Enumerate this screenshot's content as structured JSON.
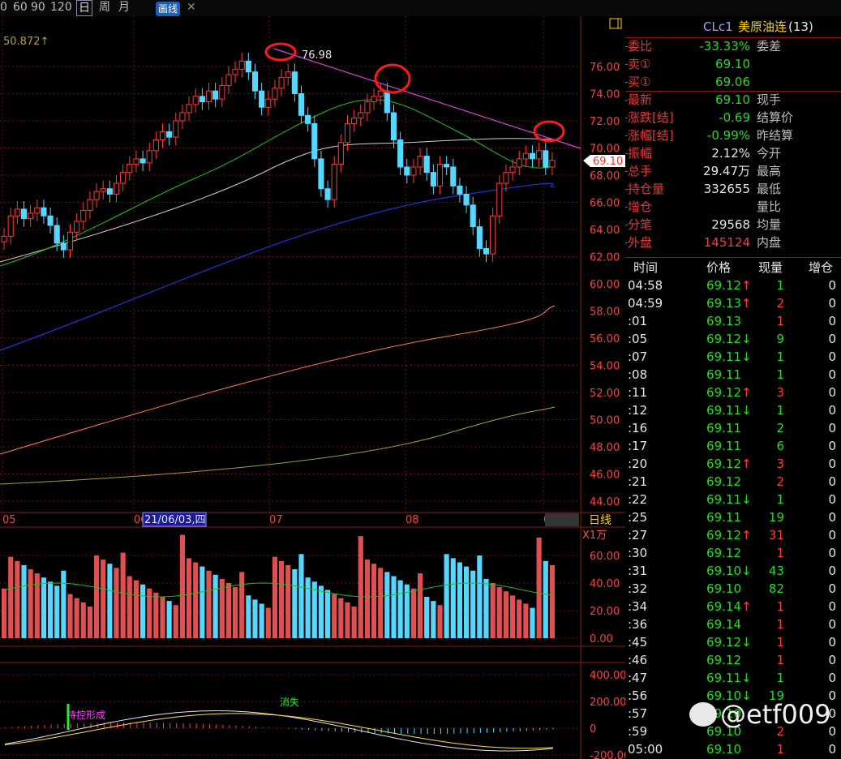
{
  "toolbar": {
    "periods": [
      "0",
      "60",
      "90",
      "120"
    ],
    "day": "日",
    "week": "周",
    "month": "月",
    "draw": "画线"
  },
  "chart": {
    "ma_label": "50.872↑",
    "peak_label": "76.98",
    "price_marker": "69.10",
    "y_ticks": [
      "76.00",
      "74.00",
      "72.00",
      "70.00",
      "68.00",
      "66.00",
      "64.00",
      "62.00",
      "60.00",
      "58.00",
      "56.00",
      "54.00",
      "52.00",
      "50.00",
      "48.00",
      "46.00",
      "44.00"
    ],
    "x_ticks": [
      "05",
      "06",
      "07",
      "08",
      "09"
    ],
    "cursor_date": "21/06/03,四",
    "period_label": "日线",
    "vol_unit": "X1万",
    "vol_ticks": [
      "60.00",
      "40.00",
      "20.00",
      "0.00"
    ],
    "macd_ticks": [
      "400.00",
      "200.00",
      "0",
      "-200.00"
    ],
    "macd_annot_1": "持控形成",
    "macd_annot_2": "消失",
    "colors": {
      "up": "#ff3a3a",
      "down": "#54d8ff",
      "ma_green": "#1fbf1f",
      "ma_white": "#cfcfcf",
      "ma_blue": "#2233dd",
      "ma_orange": "#ff7a4a",
      "ma_olive": "#a0a040",
      "trend": "#d840d8",
      "circle": "#ff1a1a",
      "grid": "#6e1010"
    }
  },
  "quote": {
    "title": "CLc1",
    "name": "美原油连",
    "count": "(13)",
    "rows": [
      {
        "l": "委比",
        "v": "-33.33%",
        "c": "green",
        "r": "委差",
        "rv": ""
      },
      {
        "l": "卖①",
        "v": "69.10",
        "c": "green",
        "r": "",
        "rv": ""
      },
      {
        "l": "买①",
        "v": "69.06",
        "c": "green",
        "r": "",
        "rv": ""
      },
      {
        "l": "最新",
        "v": "69.10",
        "c": "green",
        "r": "现手",
        "rv": ""
      },
      {
        "l": "涨跌[结]",
        "v": "-0.69",
        "c": "green",
        "r": "结算价",
        "rv": ""
      },
      {
        "l": "涨幅[结]",
        "v": "-0.99%",
        "c": "green",
        "r": "昨结算",
        "rv": ""
      },
      {
        "l": "振幅",
        "v": "2.12%",
        "c": "white",
        "r": "今开",
        "rv": ""
      },
      {
        "l": "总手",
        "v": "29.47万",
        "c": "white",
        "r": "最高",
        "rv": ""
      },
      {
        "l": "持仓量",
        "v": "332655",
        "c": "white",
        "r": "最低",
        "rv": ""
      },
      {
        "l": "增仓",
        "v": "",
        "c": "white",
        "r": "量比",
        "rv": ""
      },
      {
        "l": "分笔",
        "v": "29568",
        "c": "white",
        "r": "均量",
        "rv": ""
      },
      {
        "l": "外盘",
        "v": "145124",
        "c": "red",
        "r": "内盘",
        "rv": ""
      }
    ]
  },
  "ticks": {
    "headers": [
      "时间",
      "价格",
      "现量",
      "增仓"
    ],
    "rows": [
      {
        "t": "04:58",
        "p": "69.12",
        "a": "↑",
        "v": "1",
        "vc": "green",
        "o": "0"
      },
      {
        "t": "04:59",
        "p": "69.13",
        "a": "↑",
        "v": "2",
        "vc": "red",
        "o": "0"
      },
      {
        "t": ":01",
        "p": "69.13",
        "a": "",
        "v": "1",
        "vc": "red",
        "o": "0"
      },
      {
        "t": ":05",
        "p": "69.12",
        "a": "↓",
        "v": "9",
        "vc": "green",
        "o": "0"
      },
      {
        "t": ":07",
        "p": "69.11",
        "a": "↓",
        "v": "1",
        "vc": "green",
        "o": "0"
      },
      {
        "t": ":08",
        "p": "69.11",
        "a": "",
        "v": "1",
        "vc": "green",
        "o": "0"
      },
      {
        "t": ":11",
        "p": "69.12",
        "a": "↑",
        "v": "3",
        "vc": "red",
        "o": "0"
      },
      {
        "t": ":12",
        "p": "69.11",
        "a": "↓",
        "v": "1",
        "vc": "green",
        "o": "0"
      },
      {
        "t": ":16",
        "p": "69.11",
        "a": "",
        "v": "2",
        "vc": "green",
        "o": "0"
      },
      {
        "t": ":17",
        "p": "69.11",
        "a": "",
        "v": "6",
        "vc": "green",
        "o": "0"
      },
      {
        "t": ":20",
        "p": "69.12",
        "a": "↑",
        "v": "3",
        "vc": "red",
        "o": "0"
      },
      {
        "t": ":21",
        "p": "69.12",
        "a": "",
        "v": "2",
        "vc": "red",
        "o": "0"
      },
      {
        "t": ":22",
        "p": "69.11",
        "a": "↓",
        "v": "1",
        "vc": "green",
        "o": "0"
      },
      {
        "t": ":25",
        "p": "69.11",
        "a": "",
        "v": "19",
        "vc": "green",
        "o": "0"
      },
      {
        "t": ":27",
        "p": "69.12",
        "a": "↑",
        "v": "31",
        "vc": "red",
        "o": "0"
      },
      {
        "t": ":30",
        "p": "69.12",
        "a": "",
        "v": "1",
        "vc": "red",
        "o": "0"
      },
      {
        "t": ":31",
        "p": "69.10",
        "a": "↓",
        "v": "43",
        "vc": "green",
        "o": "0"
      },
      {
        "t": ":32",
        "p": "69.10",
        "a": "",
        "v": "82",
        "vc": "green",
        "o": "0"
      },
      {
        "t": ":34",
        "p": "69.14",
        "a": "↑",
        "v": "1",
        "vc": "red",
        "o": "0"
      },
      {
        "t": ":36",
        "p": "69.14",
        "a": "",
        "v": "1",
        "vc": "red",
        "o": "0"
      },
      {
        "t": ":45",
        "p": "69.12",
        "a": "↓",
        "v": "1",
        "vc": "red",
        "o": "0"
      },
      {
        "t": ":46",
        "p": "69.12",
        "a": "",
        "v": "1",
        "vc": "red",
        "o": "0"
      },
      {
        "t": ":47",
        "p": "69.11",
        "a": "↓",
        "v": "1",
        "vc": "green",
        "o": "0"
      },
      {
        "t": ":56",
        "p": "69.10",
        "a": "↓",
        "v": "19",
        "vc": "green",
        "o": "0"
      },
      {
        "t": ":57",
        "p": "69.10",
        "a": "",
        "v": "",
        "vc": "green",
        "o": "0"
      },
      {
        "t": ":59",
        "p": "69.10",
        "a": "",
        "v": "2",
        "vc": "red",
        "o": "0"
      },
      {
        "t": "05:00",
        "p": "69.10",
        "a": "",
        "v": "1",
        "vc": "red",
        "o": "0"
      }
    ]
  },
  "watermark": "@etf009"
}
